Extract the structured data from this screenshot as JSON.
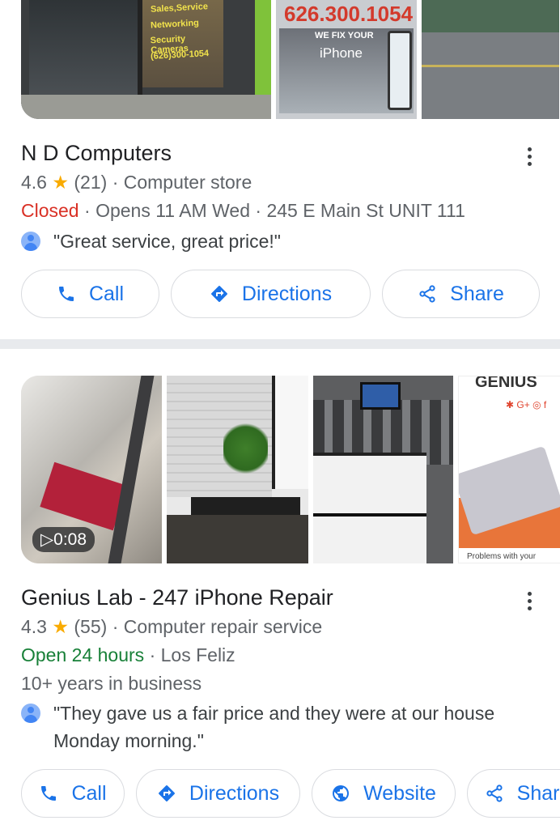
{
  "listing1": {
    "photos": {
      "storefront_sign_lines": [
        "Sales,Service",
        "Networking",
        "Security Cameras",
        "(626)300-1054"
      ],
      "phone_sign": "626.300.1054",
      "window_text_1": "WE FIX YOUR",
      "window_text_2": "iPhone"
    },
    "name": "N D Computers",
    "rating": "4.6",
    "review_count": "(21)",
    "category": "Computer store",
    "status": "Closed",
    "hours": "Opens 11 AM Wed",
    "address": "245 E Main St UNIT 111",
    "review": "\"Great service, great price!\"",
    "buttons": {
      "call": "Call",
      "directions": "Directions",
      "share": "Share"
    }
  },
  "listing2": {
    "photos": {
      "video_duration": "0:08",
      "brand_text": "GENIUS",
      "caption": "Problems with your"
    },
    "name": "Genius Lab - 247 iPhone Repair",
    "rating": "4.3",
    "review_count": "(55)",
    "category": "Computer repair service",
    "status": "Open 24 hours",
    "neighborhood": "Los Feliz",
    "years": "10+ years in business",
    "review": "\"They gave us a fair price and they were at our house Monday morning.\"",
    "buttons": {
      "call": "Call",
      "directions": "Directions",
      "website": "Website",
      "share": "Share"
    }
  },
  "colors": {
    "accent": "#1a73e8",
    "closed": "#d93025",
    "open": "#188038",
    "star": "#f9ab00"
  },
  "icons": [
    "phone-icon",
    "directions-icon",
    "share-icon",
    "globe-icon",
    "more-vert-icon",
    "star-icon",
    "play-icon",
    "avatar-icon"
  ]
}
